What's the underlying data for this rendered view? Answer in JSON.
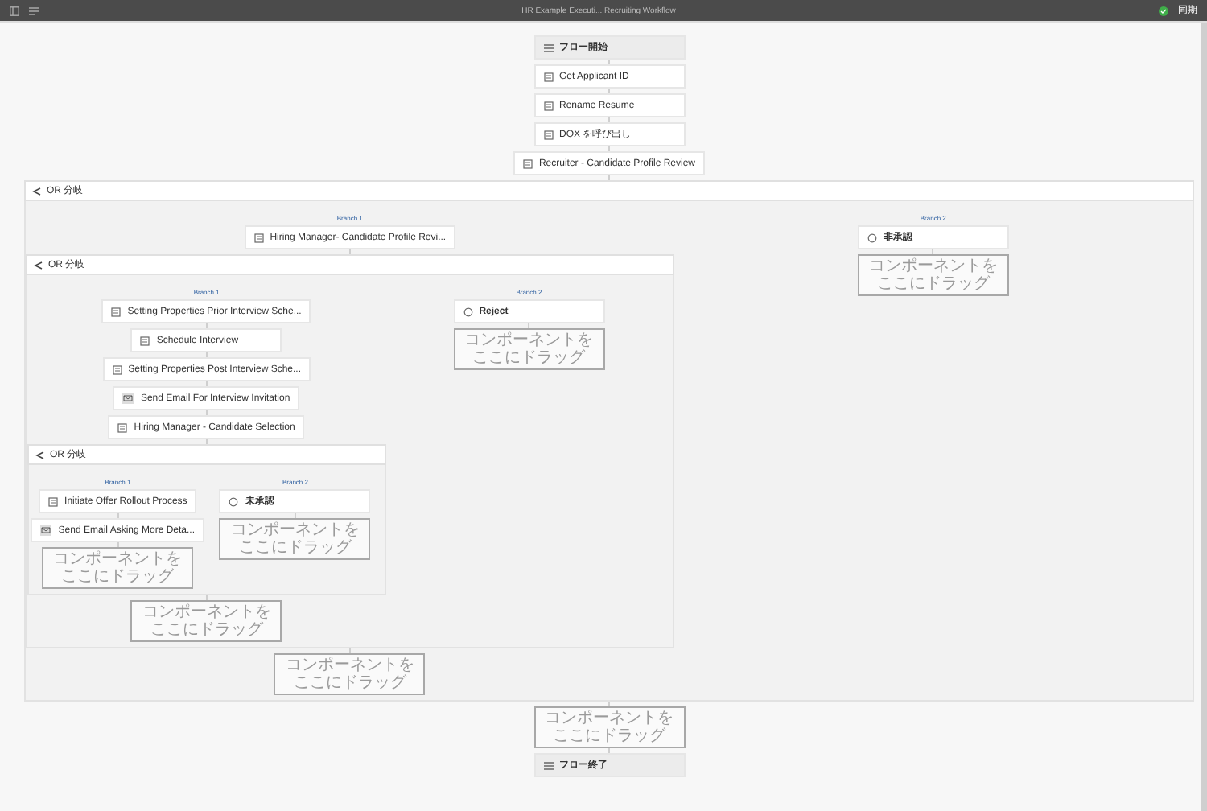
{
  "topbar": {
    "title": "HR Example Executi... Recruiting Workflow",
    "status": "同期"
  },
  "flow": [
    {
      "kind": "start",
      "label": "フロー開始"
    },
    {
      "kind": "step",
      "label": "Get Applicant ID"
    },
    {
      "kind": "step",
      "label": "Rename Resume"
    },
    {
      "kind": "step",
      "label": "DOX を呼び出し"
    },
    {
      "kind": "step",
      "label": "Recruiter - Candidate Profile Review"
    },
    {
      "kind": "or",
      "label": "OR 分岐",
      "branches": [
        {
          "label": "Branch 1",
          "steps": [
            {
              "kind": "step",
              "label": "Hiring Manager- Candidate Profile Revi..."
            },
            {
              "kind": "or",
              "label": "OR 分岐",
              "branches": [
                {
                  "label": "Branch 1",
                  "steps": [
                    {
                      "kind": "step",
                      "label": "Setting Properties Prior Interview Sche..."
                    },
                    {
                      "kind": "step",
                      "label": "Schedule Interview"
                    },
                    {
                      "kind": "step",
                      "label": "Setting Properties Post Interview Sche..."
                    },
                    {
                      "kind": "email",
                      "label": "Send Email For Interview Invitation"
                    },
                    {
                      "kind": "step",
                      "label": "Hiring Manager - Candidate Selection"
                    },
                    {
                      "kind": "or",
                      "label": "OR 分岐",
                      "branches": [
                        {
                          "label": "Branch 1",
                          "steps": [
                            {
                              "kind": "step",
                              "label": "Initiate Offer Rollout Process"
                            },
                            {
                              "kind": "email",
                              "label": "Send Email Asking More Deta..."
                            },
                            {
                              "kind": "drop",
                              "label": "コンポーネントをここにドラッグ"
                            }
                          ]
                        },
                        {
                          "label": "Branch 2",
                          "steps": [
                            {
                              "kind": "decision",
                              "label": "未承認"
                            },
                            {
                              "kind": "drop",
                              "label": "コンポーネントをここにドラッグ"
                            }
                          ]
                        }
                      ]
                    },
                    {
                      "kind": "drop",
                      "label": "コンポーネントをここにドラッグ"
                    }
                  ]
                },
                {
                  "label": "Branch 2",
                  "steps": [
                    {
                      "kind": "decision",
                      "label": "Reject"
                    },
                    {
                      "kind": "drop",
                      "label": "コンポーネントをここにドラッグ"
                    }
                  ]
                }
              ]
            },
            {
              "kind": "drop",
              "label": "コンポーネントをここにドラッグ"
            }
          ]
        },
        {
          "label": "Branch 2",
          "steps": [
            {
              "kind": "decision",
              "label": "非承認"
            },
            {
              "kind": "drop",
              "label": "コンポーネントをここにドラッグ"
            }
          ]
        }
      ]
    },
    {
      "kind": "drop",
      "label": "コンポーネントをここにドラッグ"
    },
    {
      "kind": "end",
      "label": "フロー終了"
    }
  ]
}
